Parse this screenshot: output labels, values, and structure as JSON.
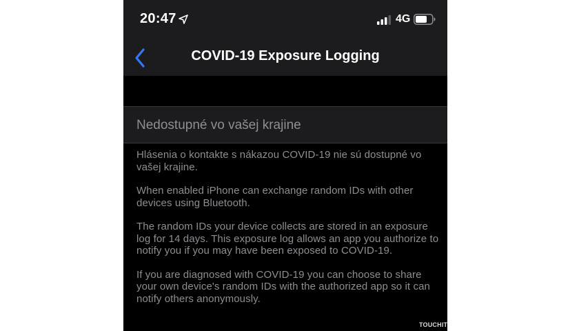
{
  "status_bar": {
    "time": "20:47",
    "network": "4G"
  },
  "nav": {
    "title": "COVID-19 Exposure Logging"
  },
  "section": {
    "header": "Nedostupné vo vašej krajine"
  },
  "body": {
    "paragraphs": [
      "Hlásenia o kontakte s nákazou COVID-19 nie sú dostupné vo vašej krajine.",
      "When enabled iPhone can exchange random IDs with other devices using Bluetooth.",
      "The random IDs your device collects are stored in an exposure log for 14 days. This exposure log allows an app you authorize to notify you if you may have been exposed to COVID-19.",
      "If you are diagnosed with COVID-19 you can choose to share your own device's random IDs with the authorized app so it can notify others anonymously."
    ]
  },
  "watermark": "TOUCHIT",
  "icons": {
    "back": "chevron-left-icon",
    "location": "location-arrow-icon",
    "signal": "cellular-signal-icon",
    "battery": "battery-icon"
  },
  "colors": {
    "accent": "#3478f6",
    "background": "#000000",
    "bar_background": "#1c1c1e",
    "secondary_text": "#8e8e93"
  }
}
